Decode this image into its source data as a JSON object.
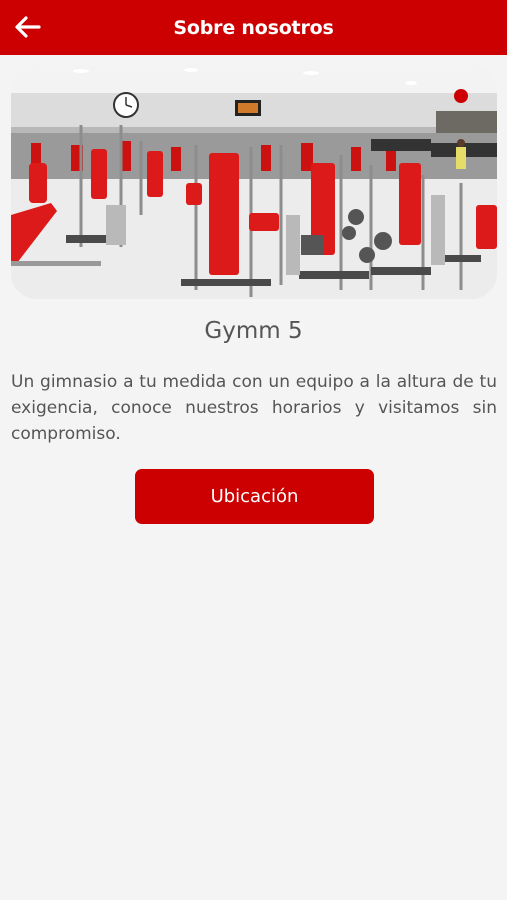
{
  "header": {
    "title": "Sobre nosotros",
    "back_icon": "arrow-left-icon"
  },
  "hero": {
    "image": "gym-interior-photo"
  },
  "main": {
    "gym_name": "Gymm 5",
    "description": "Un gimnasio a tu medida con un equipo a la altura de tu exigencia, conoce nuestros horarios y visitamos sin compromiso.",
    "location_button_label": "Ubicación"
  },
  "colors": {
    "brand_red": "#cc0000",
    "background": "#f4f4f4",
    "text_gray": "#555555"
  }
}
